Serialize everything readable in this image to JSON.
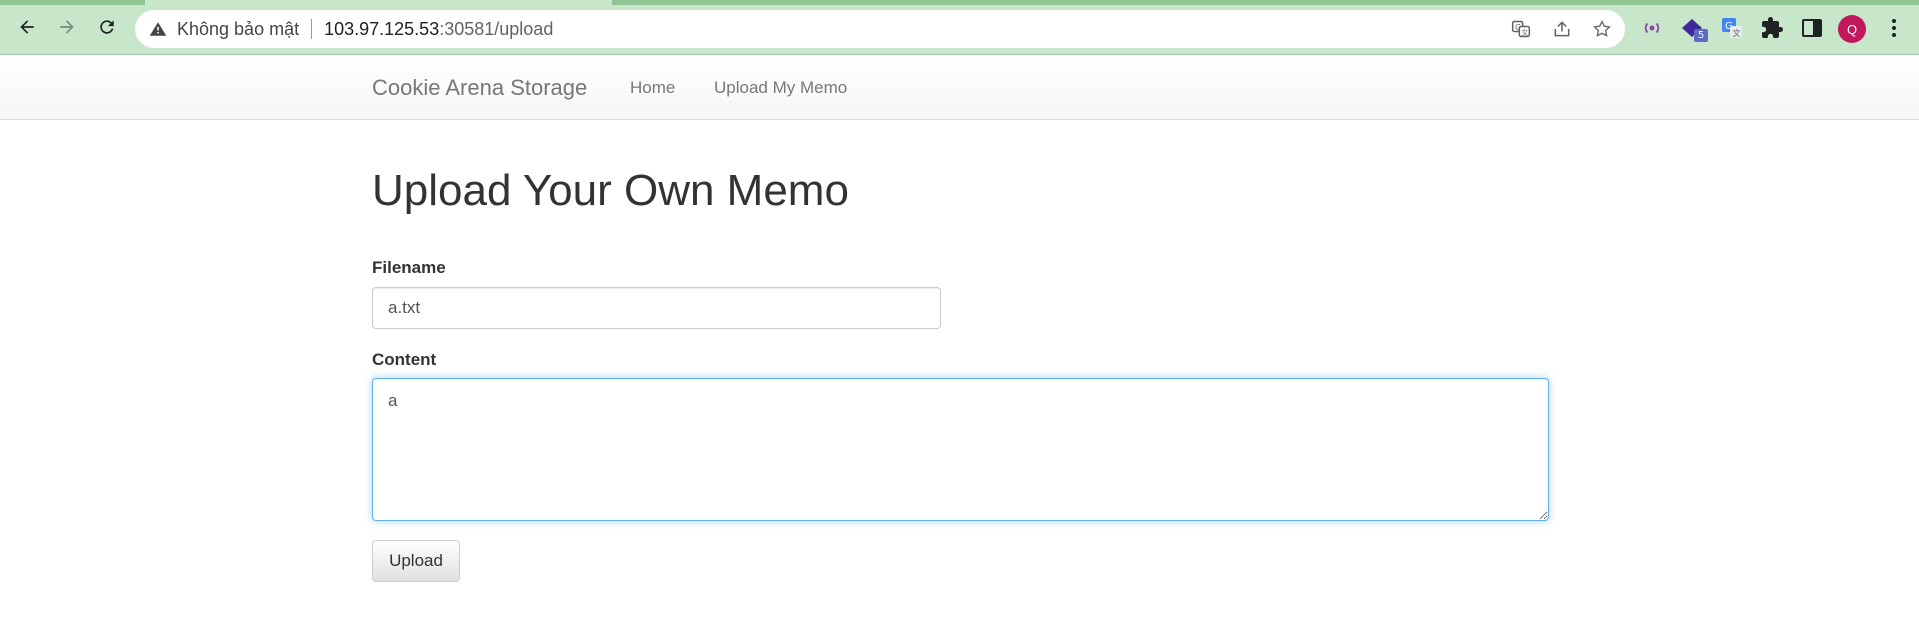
{
  "browser": {
    "security_label": "Không bảo mật",
    "url_host": "103.97.125.53",
    "url_path": ":30581/upload",
    "extension_badge": "5",
    "profile_initial": "Q",
    "accent_color": "#c8e6c9"
  },
  "navbar": {
    "brand": "Cookie Arena Storage",
    "links": [
      "Home",
      "Upload My Memo"
    ]
  },
  "form": {
    "title": "Upload Your Own Memo",
    "filename_label": "Filename",
    "filename_value": "a.txt",
    "content_label": "Content",
    "content_value": "a",
    "submit_label": "Upload"
  }
}
